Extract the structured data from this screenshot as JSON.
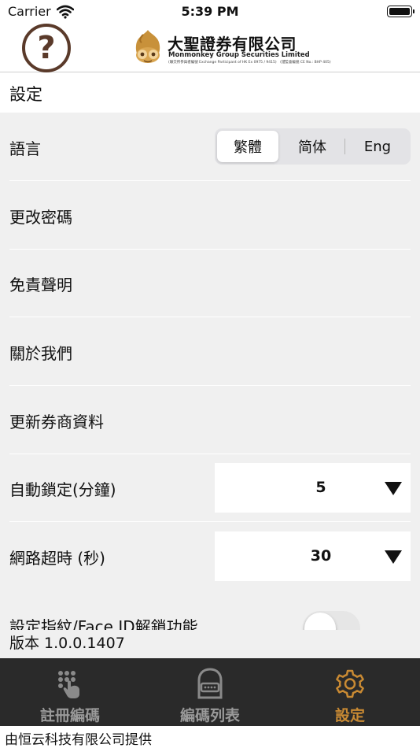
{
  "status_bar": {
    "carrier": "Carrier",
    "time": "5:39 PM"
  },
  "header": {
    "help_symbol": "?",
    "logo": {
      "name": "大聖證券有限公司",
      "english": "Monmonkey Group Securities Limited",
      "fine_print": "(聯交所參與者編號 Exchange Participant of HK Ex 0975 / 9415)　(證監會編號 CE No.: BHP 405)"
    }
  },
  "page_title": "設定",
  "settings": {
    "language": {
      "label": "語言",
      "options": [
        "繁體",
        "简体",
        "Eng"
      ],
      "selected": "繁體"
    },
    "change_password": "更改密碼",
    "disclaimer": "免責聲明",
    "about_us": "關於我們",
    "update_broker_info": "更新券商資料",
    "auto_lock": {
      "label": "自動鎖定(分鐘)",
      "value": "5"
    },
    "network_timeout": {
      "label": "網路超時 (秒)",
      "value": "30"
    },
    "biometric": {
      "label": "設定指紋/Face ID解鎖功能",
      "enabled": false
    }
  },
  "version": "版本 1.0.0.1407",
  "tabs": [
    {
      "label": "註冊編碼",
      "icon": "keypad-hand-icon",
      "active": false
    },
    {
      "label": "編碼列表",
      "icon": "token-device-icon",
      "active": false
    },
    {
      "label": "設定",
      "icon": "gear-icon",
      "active": true
    }
  ],
  "colors": {
    "accent": "#c98a33",
    "tabbar_bg": "#2a2a2a",
    "help_icon": "#5a3a2a",
    "list_bg": "#f0f0f0"
  },
  "footer": "由恒云科技有限公司提供"
}
